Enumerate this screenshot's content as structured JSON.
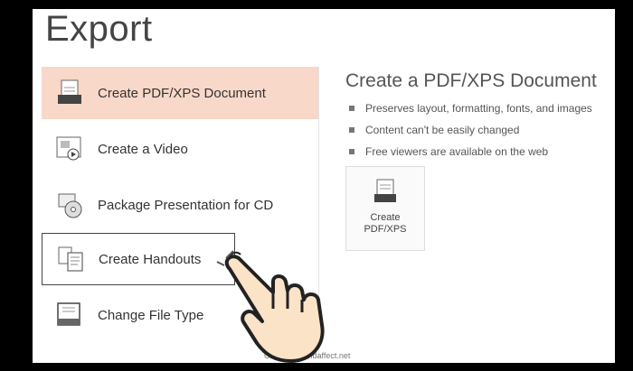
{
  "page": {
    "title": "Export"
  },
  "menu": {
    "items": [
      {
        "label": "Create PDF/XPS Document",
        "icon": "pdf-document-icon",
        "selected": true
      },
      {
        "label": "Create a Video",
        "icon": "video-icon"
      },
      {
        "label": "Package Presentation for CD",
        "icon": "package-cd-icon"
      },
      {
        "label": "Create Handouts",
        "icon": "handouts-icon",
        "highlighted": true
      },
      {
        "label": "Change File Type",
        "icon": "file-type-icon"
      }
    ]
  },
  "detail": {
    "title": "Create a PDF/XPS Document",
    "bullets": [
      "Preserves layout, formatting, fonts, and images",
      "Content can't be easily changed",
      "Free viewers are available on the web"
    ],
    "button": {
      "line1": "Create",
      "line2": "PDF/XPS",
      "icon": "pdf-xps-icon"
    }
  },
  "footer": {
    "text": "Create by smdaffect.net"
  },
  "colors": {
    "selected_bg": "#f8d8c8",
    "hand_fill": "#fbe3c8",
    "hand_stroke": "#222222"
  }
}
